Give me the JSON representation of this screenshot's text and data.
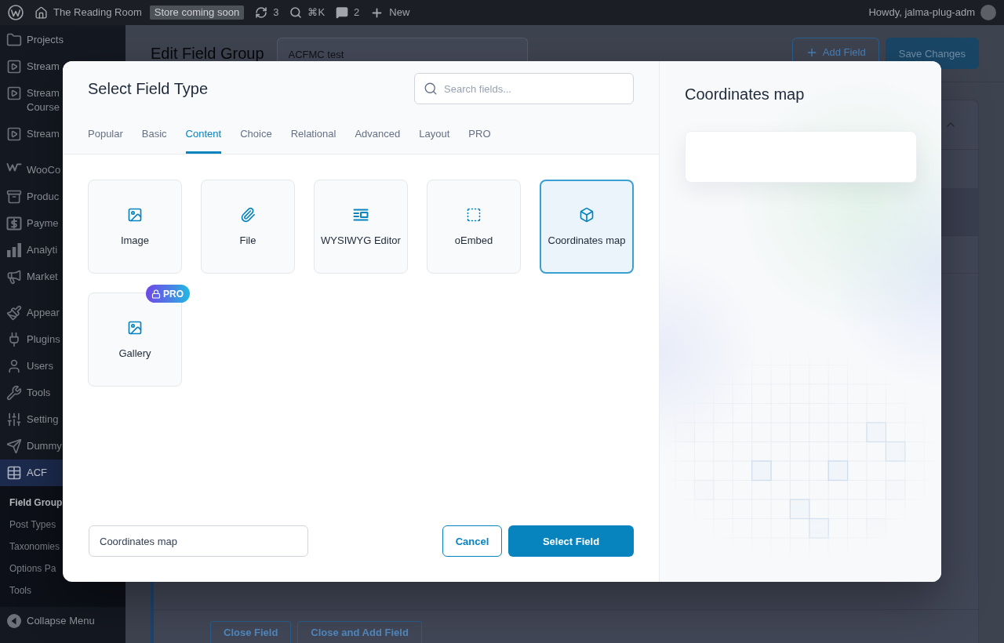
{
  "admin_bar": {
    "site_name": "The Reading Room",
    "store_badge": "Store coming soon",
    "updates_count": "3",
    "search_shortcut": "⌘K",
    "comments_count": "2",
    "new_label": "New",
    "greeting": "Howdy, jalma-plug-adm"
  },
  "sidebar": {
    "groups": [
      {
        "items": [
          {
            "label": "Projects",
            "selected": false
          },
          {
            "label": "Stream",
            "selected": false
          },
          {
            "label": "Stream Course",
            "selected": false
          },
          {
            "label": "Stream",
            "selected": false
          }
        ]
      },
      {
        "items": [
          {
            "label": "WooCo",
            "selected": false
          },
          {
            "label": "Produc",
            "selected": false
          },
          {
            "label": "Payme",
            "selected": false
          },
          {
            "label": "Analyti",
            "selected": false
          },
          {
            "label": "Market",
            "selected": false
          }
        ]
      },
      {
        "items": [
          {
            "label": "Appear",
            "selected": false
          },
          {
            "label": "Plugins",
            "selected": false
          },
          {
            "label": "Users",
            "selected": false
          },
          {
            "label": "Tools",
            "selected": false
          },
          {
            "label": "Setting",
            "selected": false
          },
          {
            "label": "Dummy",
            "selected": false
          },
          {
            "label": "ACF",
            "selected": true
          }
        ]
      }
    ],
    "submenu": [
      {
        "label": "Field Group",
        "selected": true
      },
      {
        "label": "Post Types",
        "selected": false
      },
      {
        "label": "Taxonomies",
        "selected": false
      },
      {
        "label": "Options Pa",
        "selected": false
      },
      {
        "label": "Tools",
        "selected": false
      }
    ],
    "collapse_label": "Collapse Menu"
  },
  "page": {
    "title": "Edit Field Group",
    "group_title": {
      "value": "ACFMC test"
    },
    "add_field_button": "Add Field",
    "save_button": "Save Changes",
    "field_buttons": [
      "Close Field",
      "Close and Add Field"
    ]
  },
  "modal": {
    "title": "Select Field Type",
    "search": {
      "placeholder": "Search fields..."
    },
    "tabs": [
      {
        "label": "Popular",
        "selected": false
      },
      {
        "label": "Basic",
        "selected": false
      },
      {
        "label": "Content",
        "selected": true
      },
      {
        "label": "Choice",
        "selected": false
      },
      {
        "label": "Relational",
        "selected": false
      },
      {
        "label": "Advanced",
        "selected": false
      },
      {
        "label": "Layout",
        "selected": false
      },
      {
        "label": "PRO",
        "selected": false
      }
    ],
    "field_types": [
      {
        "label": "Image",
        "selected": false
      },
      {
        "label": "File",
        "selected": false
      },
      {
        "label": "WYSIWYG Editor",
        "selected": false
      },
      {
        "label": "oEmbed",
        "selected": false
      },
      {
        "label": "Coordinates map",
        "selected": true
      },
      {
        "label": "Gallery",
        "selected": false,
        "badge": "PRO"
      }
    ],
    "name_field": {
      "value": "Coordinates map"
    },
    "actions": {
      "cancel": "Cancel",
      "confirm": "Select Field"
    },
    "preview": {
      "title": "Coordinates map"
    }
  }
}
